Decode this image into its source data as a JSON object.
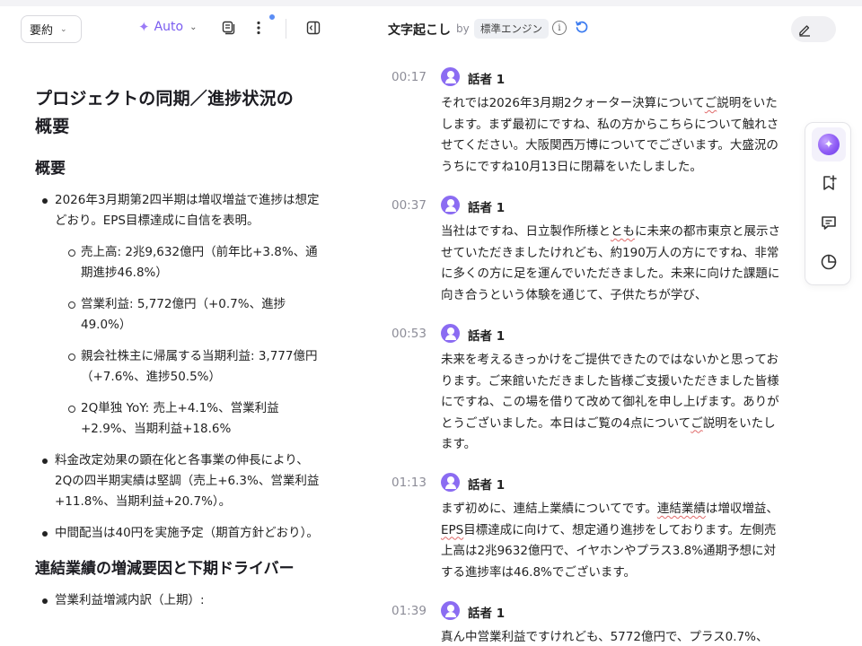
{
  "left_toolbar": {
    "mode_select": "要約",
    "auto_label": "Auto"
  },
  "summary": {
    "title_line1": "プロジェクトの同期／進捗状況の",
    "title_line2": "概要",
    "sections": [
      {
        "heading": "概要",
        "bullets": [
          {
            "text": "2026年3月期第2四半期は増収増益で進捗は想定どおり。EPS目標達成に自信を表明。",
            "sub": [
              "売上高: 2兆9,632億円（前年比+3.8%、通期進捗46.8%）",
              "営業利益: 5,772億円（+0.7%、進捗49.0%）",
              "親会社株主に帰属する当期利益: 3,777億円（+7.6%、進捗50.5%）",
              "2Q単独 YoY: 売上+4.1%、営業利益+2.9%、当期利益+18.6%"
            ]
          },
          {
            "text": "料金改定効果の顕在化と各事業の伸長により、2Qの四半期実績は堅調（売上+6.3%、営業利益+11.8%、当期利益+20.7%）。"
          },
          {
            "text": "中間配当は40円を実施予定（期首方針どおり）。"
          }
        ]
      },
      {
        "heading": "連結業績の増減要因と下期ドライバー",
        "bullets": [
          {
            "text": "営業利益増減内訳（上期）:"
          }
        ]
      }
    ]
  },
  "transcript": {
    "title": "文字起こし",
    "by": "by",
    "engine": "標準エンジン",
    "segments": [
      {
        "time": "00:17",
        "speaker": "話者 1",
        "parts": [
          "それでは2026年3月期2クォーター決算について",
          "ご",
          "説明をいたします。まず最初にですね、私の方からこちらについて触れさせてください。大阪関西万博についてでございます。大盛況のうちにですね10月13日に閉幕をいたしました。"
        ]
      },
      {
        "time": "00:37",
        "speaker": "話者 1",
        "parts": [
          "当社はですね、日立製作所様と",
          "とも",
          "に未来の都市東京と展示させていただきましたけれども、約190万人の方にですね、非常に多くの方に足を運んでいただきました。未来に向けた課題に向き合うという体験を通じて、子供たちが学び、"
        ]
      },
      {
        "time": "00:53",
        "speaker": "話者 1",
        "parts": [
          "未来を考えるきっかけをご提供できたのではないかと思っております。ご来館いただきました皆様ご支援いただきました皆様にですね、この場を借りて改めて御礼を申し上げます。ありがとうございました。本日はご覧の4点について",
          "ご",
          "説明をいたします。"
        ]
      },
      {
        "time": "01:13",
        "speaker": "話者 1",
        "parts": [
          "まず初めに、連結上業績についてです。",
          "連結業績",
          "は増収増益、",
          "EPS",
          "目標達成に向けて、想定通り進捗をしております。左側売上高は2兆9632億円で、イヤホンやプラス3.8%通期予想に対する進捗率は46.8%でございます。"
        ]
      },
      {
        "time": "01:39",
        "speaker": "話者 1",
        "parts": [
          "真ん中営業利益ですけれども、5772億円で、プラス0.7%、"
        ]
      }
    ]
  },
  "icons": {
    "mode_chevron": "chevron-down-icon",
    "sparkle": "sparkle-icon",
    "copy": "copy-icon",
    "more": "more-vertical-icon",
    "panel": "panel-toggle-icon",
    "info": "info-icon",
    "refresh": "refresh-icon",
    "edit": "pencil-icon",
    "ai": "ai-assistant-icon",
    "bookmark": "bookmark-add-icon",
    "comment": "comment-icon",
    "chart": "pie-chart-icon"
  },
  "colors": {
    "accent": "#7a5cf0",
    "avatar": "#8b6cf2",
    "refresh": "#3b7bf0",
    "notification_dot": "#5a8df5",
    "spellcheck": "#e06a6a"
  }
}
